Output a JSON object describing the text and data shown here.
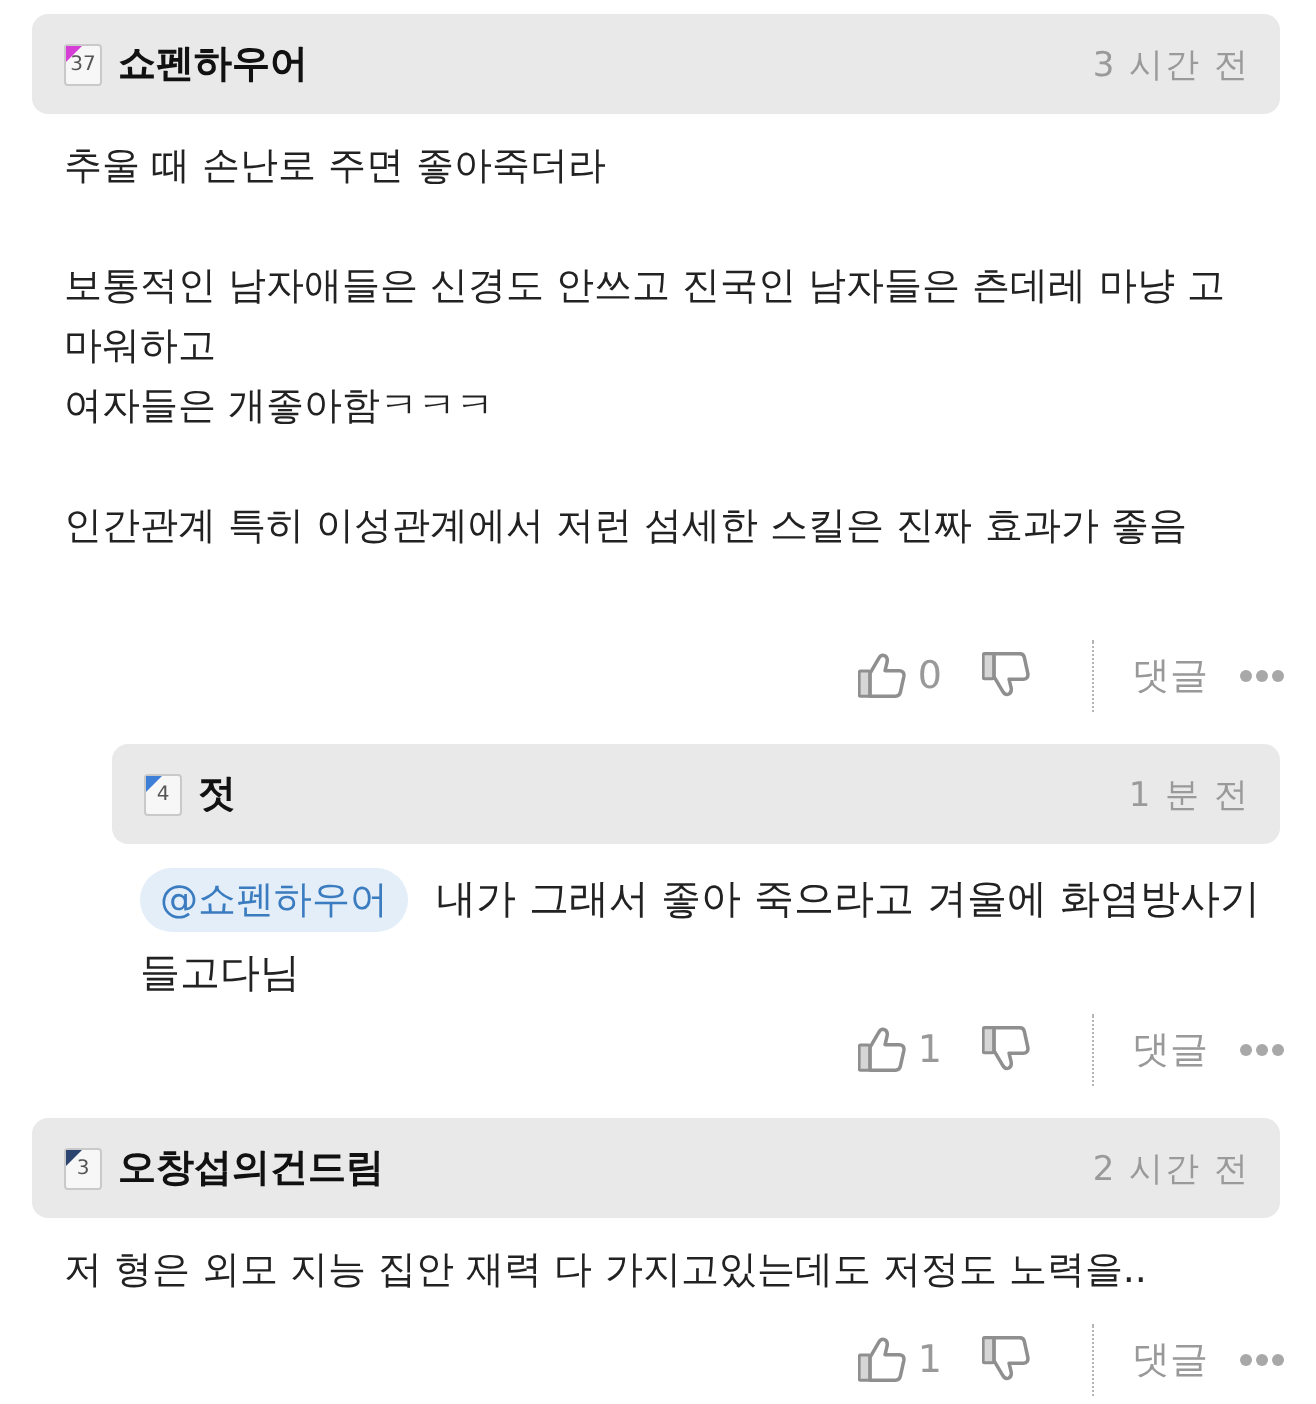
{
  "comments": [
    {
      "badge": {
        "text": "37",
        "color": "#d63fd6"
      },
      "author": "쇼펜하우어",
      "time": "3 시간 전",
      "text": "추울 때 손난로 주면 좋아죽더라\n\n보통적인 남자애들은 신경도 안쓰고 진국인 남자들은 츤데레 마냥 고마워하고\n여자들은 개좋아함ㅋㅋㅋ\n\n인간관계 특히 이성관계에서 저런 섬세한 스킬은 진짜 효과가 좋음\n\n",
      "likes": "0",
      "reply_label": "댓글",
      "replies": [
        {
          "badge": {
            "text": "4",
            "color": "#3d7fd6"
          },
          "author": "젓",
          "time": "1 분 전",
          "mention": "@쇼펜하우어",
          "text": "내가 그래서 좋아 죽으라고 겨울에 화염방사기 들고다님",
          "likes": "1",
          "reply_label": "댓글"
        }
      ]
    },
    {
      "badge": {
        "text": "3",
        "color": "#2c4470"
      },
      "author": "오창섭의건드림",
      "time": "2 시간 전",
      "text": "저 형은 외모 지능 집안 재력 다 가지고있는데도 저정도 노력을..",
      "likes": "1",
      "reply_label": "댓글"
    }
  ]
}
